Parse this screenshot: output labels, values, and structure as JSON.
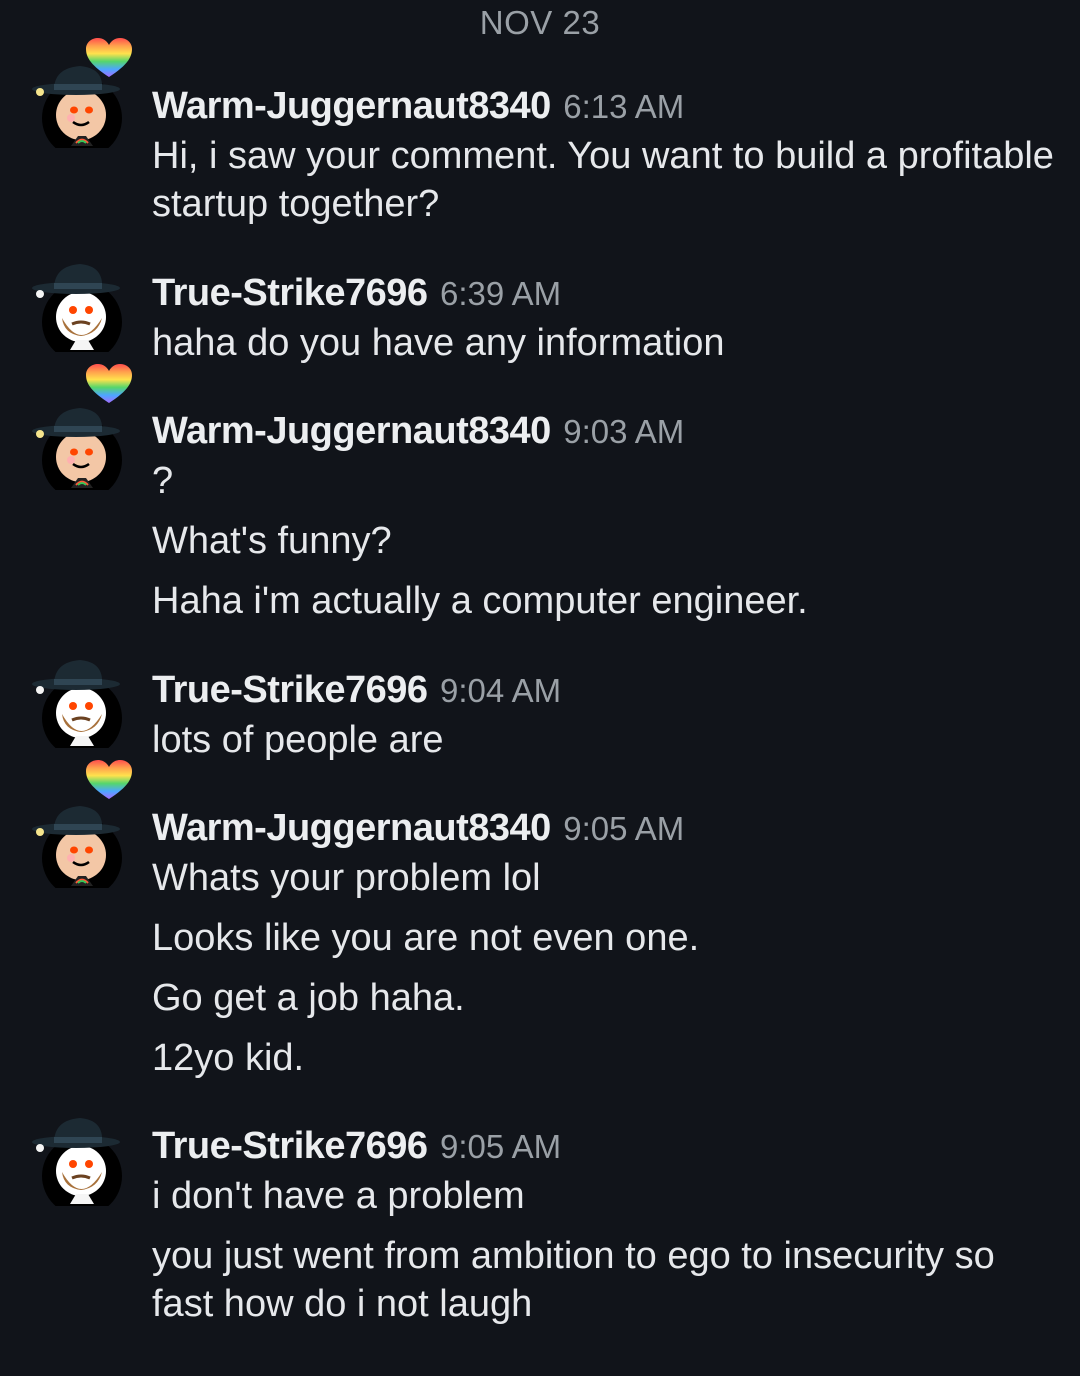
{
  "date_divider": "NOV 23",
  "messages": [
    {
      "username": "Warm-Juggernaut8340",
      "time": "6:13 AM",
      "lines": [
        "Hi, i saw your comment. You want to build a profitable startup together?"
      ]
    },
    {
      "username": "True-Strike7696",
      "time": "6:39 AM",
      "lines": [
        "haha do you have any information"
      ]
    },
    {
      "username": "Warm-Juggernaut8340",
      "time": "9:03 AM",
      "lines": [
        "?",
        "What's funny?",
        "Haha i'm actually a computer engineer."
      ]
    },
    {
      "username": "True-Strike7696",
      "time": "9:04 AM",
      "lines": [
        "lots of people are"
      ]
    },
    {
      "username": "Warm-Juggernaut8340",
      "time": "9:05 AM",
      "lines": [
        "Whats your problem lol",
        "Looks like you are not even one.",
        "Go get a job haha.",
        "12yo kid."
      ]
    },
    {
      "username": "True-Strike7696",
      "time": "9:05 AM",
      "lines": [
        "i don't have a problem",
        "you just went from ambition to ego to insecurity so fast how do i not laugh"
      ]
    }
  ],
  "avatars": {
    "warm": "snoo-avatar-with-rainbow-heart",
    "true": "snoo-avatar-with-beard"
  },
  "colors": {
    "background": "#11141a",
    "text": "#e6e8eb",
    "muted": "#9aa0a6"
  }
}
